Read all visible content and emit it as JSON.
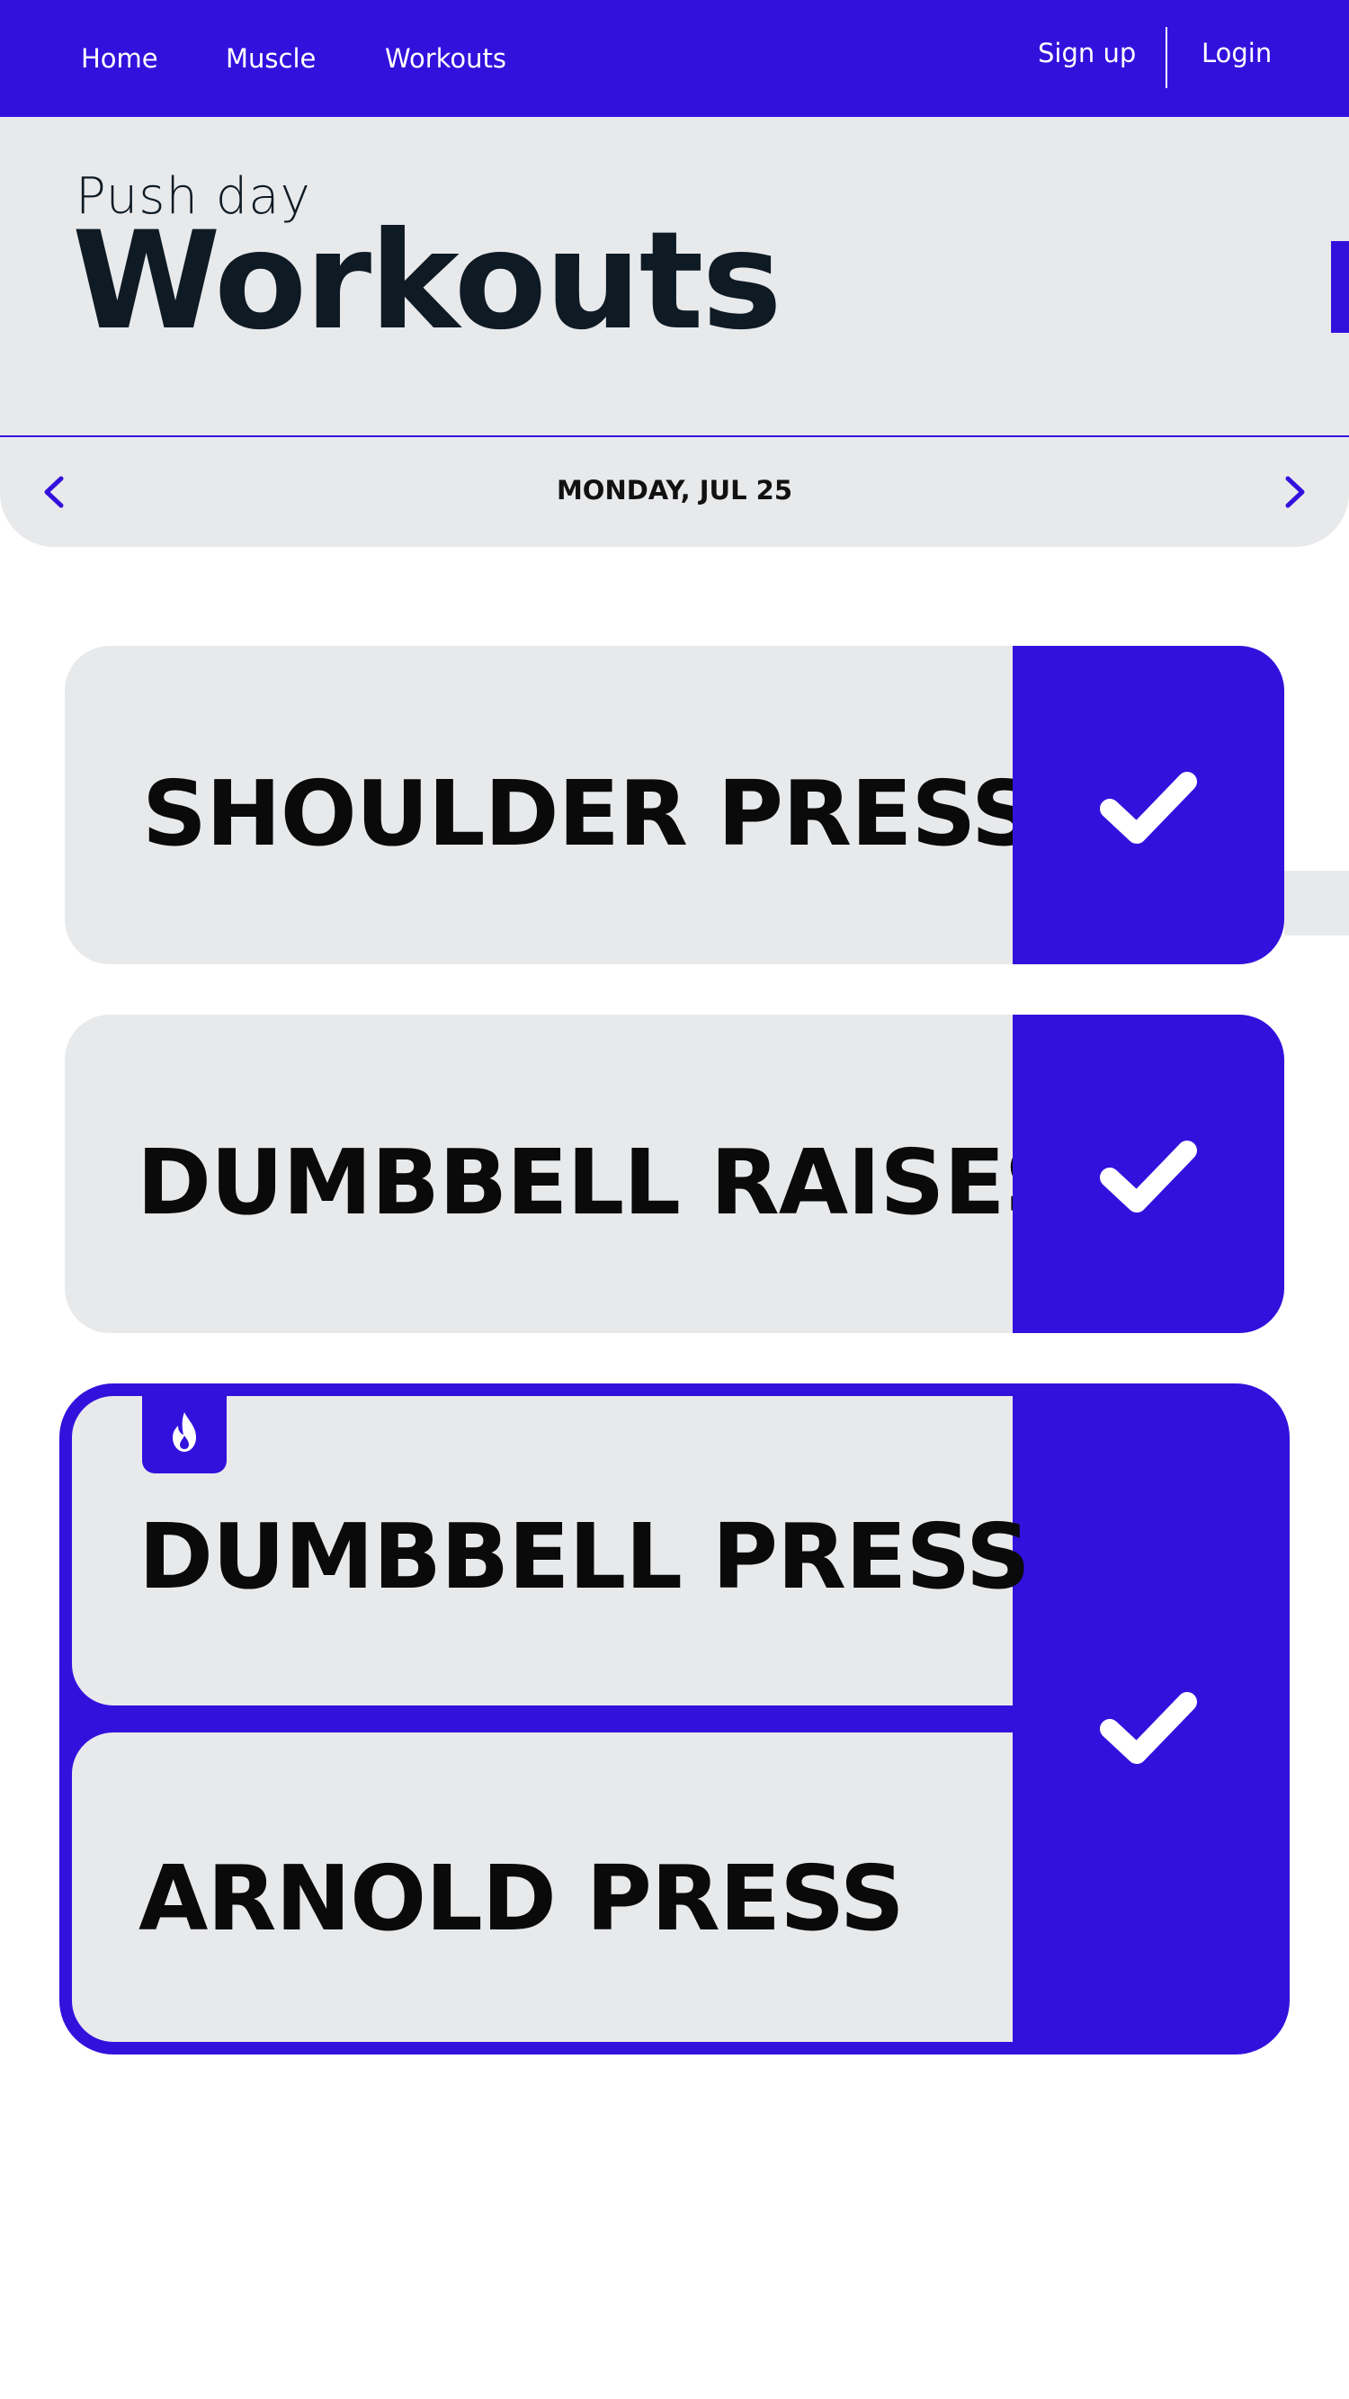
{
  "nav": {
    "links": [
      "Home",
      "Muscle",
      "Workouts"
    ],
    "signup": "Sign up",
    "login": "Login"
  },
  "header": {
    "subtitle": "Push day",
    "title": "Workouts"
  },
  "datebar": {
    "date": "MONDAY, JUL 25"
  },
  "exercises": [
    {
      "name": "SHOULDER PRESS",
      "completed": true
    },
    {
      "name": "DUMBBELL RAISES",
      "completed": true
    }
  ],
  "superset": {
    "badge_icon": "fire-icon",
    "exercises": [
      {
        "name": "DUMBBELL PRESS"
      },
      {
        "name": "ARNOLD PRESS"
      }
    ],
    "completed": true
  },
  "icons": {
    "prev": "chevron-left-icon",
    "next": "chevron-right-icon",
    "check": "check-icon"
  },
  "colors": {
    "accent": "#3311dd",
    "surface": "#e8e9eb",
    "text": "#0e1a24"
  }
}
